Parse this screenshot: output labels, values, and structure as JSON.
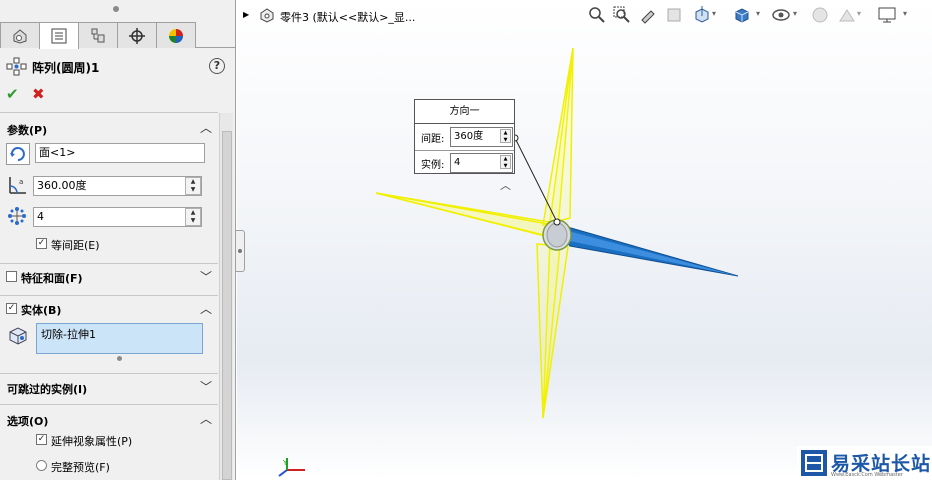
{
  "feature": {
    "title": "阵列(圆周)1",
    "help": "?"
  },
  "actions": {
    "ok": "✔",
    "cancel": "✖"
  },
  "sections": {
    "params": {
      "title": "参数(P)",
      "axis_value": "面<1>",
      "angle_value": "360.00度",
      "count_value": "4",
      "equal_spacing_label": "等间距(E)",
      "equal_spacing_checked": true
    },
    "features_faces": {
      "title": "特征和面(F)",
      "checked": false
    },
    "bodies": {
      "title": "实体(B)",
      "checked": true,
      "selected_item": "切除-拉伸1"
    },
    "skip": {
      "title": "可跳过的实例(I)"
    },
    "options": {
      "title": "选项(O)",
      "propagate_label": "延伸视象属性(P)",
      "propagate_checked": true,
      "full_preview_label": "完整预览(F)"
    }
  },
  "breadcrumb": {
    "text": "零件3  (默认<<默认>_显..."
  },
  "callout": {
    "title": "方向一",
    "spacing_label": "间距:",
    "spacing_value": "360度",
    "instances_label": "实例:",
    "instances_value": "4"
  },
  "watermark": {
    "title": "易采站长站",
    "subtitle": "Www.Easck.Com  Webmaster"
  },
  "colors": {
    "selection": "#cce4f7",
    "preview": "#ffff00",
    "body": "#1a6fc0",
    "brand": "#1d57a8"
  }
}
